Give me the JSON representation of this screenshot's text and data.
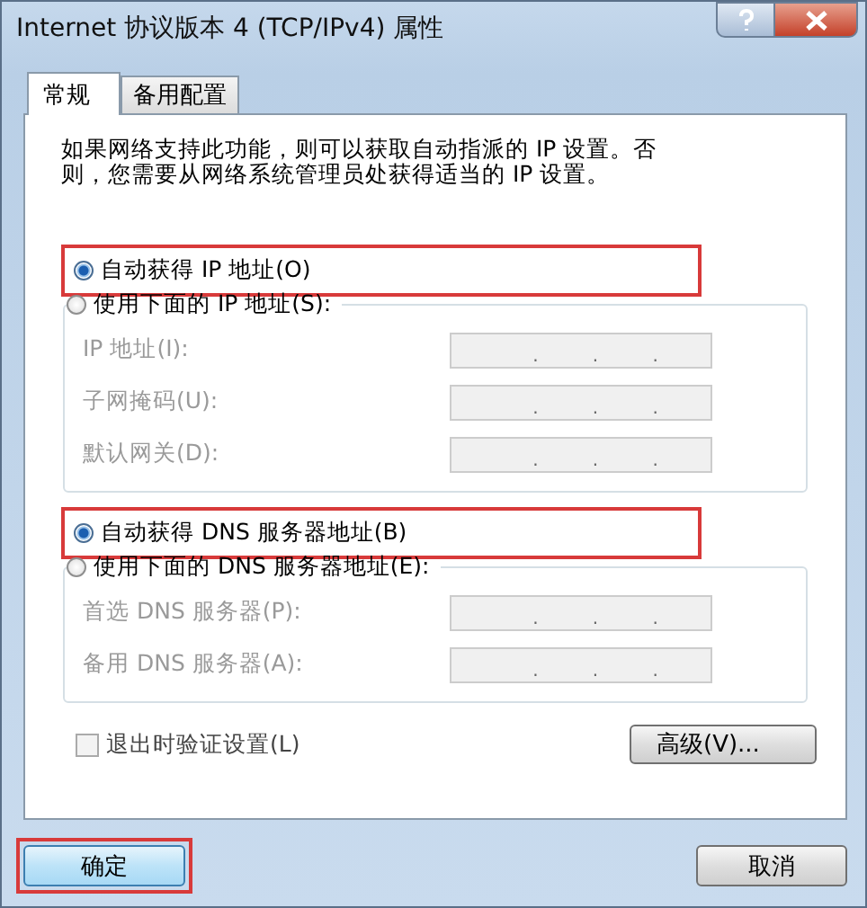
{
  "window": {
    "title": "Internet 协议版本 4 (TCP/IPv4) 属性"
  },
  "tabs": [
    {
      "label": "常规",
      "selected": true
    },
    {
      "label": "备用配置",
      "selected": false
    }
  ],
  "description": "如果网络支持此功能，则可以获取自动指派的 IP 设置。否则，您需要从网络系统管理员处获得适当的 IP 设置。",
  "sections": [
    {
      "auto_option": {
        "label": "自动获得 IP 地址(O)",
        "selected": true,
        "highlighted": true
      },
      "manual_option": {
        "label": "使用下面的 IP 地址(S):",
        "selected": false
      },
      "fields": [
        {
          "label": "IP 地址(I):",
          "separators": [
            ".",
            ".",
            "."
          ],
          "disabled": true
        },
        {
          "label": "子网掩码(U):",
          "separators": [
            ".",
            ".",
            "."
          ],
          "disabled": true
        },
        {
          "label": "默认网关(D):",
          "separators": [
            ".",
            ".",
            "."
          ],
          "disabled": true
        }
      ]
    },
    {
      "auto_option": {
        "label": "自动获得 DNS 服务器地址(B)",
        "selected": true,
        "highlighted": true
      },
      "manual_option": {
        "label": "使用下面的 DNS 服务器地址(E):",
        "selected": false
      },
      "fields": [
        {
          "label": "首选 DNS 服务器(P):",
          "separators": [
            ".",
            ".",
            "."
          ],
          "disabled": true
        },
        {
          "label": "备用 DNS 服务器(A):",
          "separators": [
            ".",
            ".",
            "."
          ],
          "disabled": true
        }
      ]
    }
  ],
  "validate_checkbox": {
    "label": "退出时验证设置(L)",
    "checked": false
  },
  "advanced_button": {
    "label": "高级(V)..."
  },
  "ok_button": {
    "label": "确定",
    "highlighted": true
  },
  "cancel_button": {
    "label": "取消"
  }
}
